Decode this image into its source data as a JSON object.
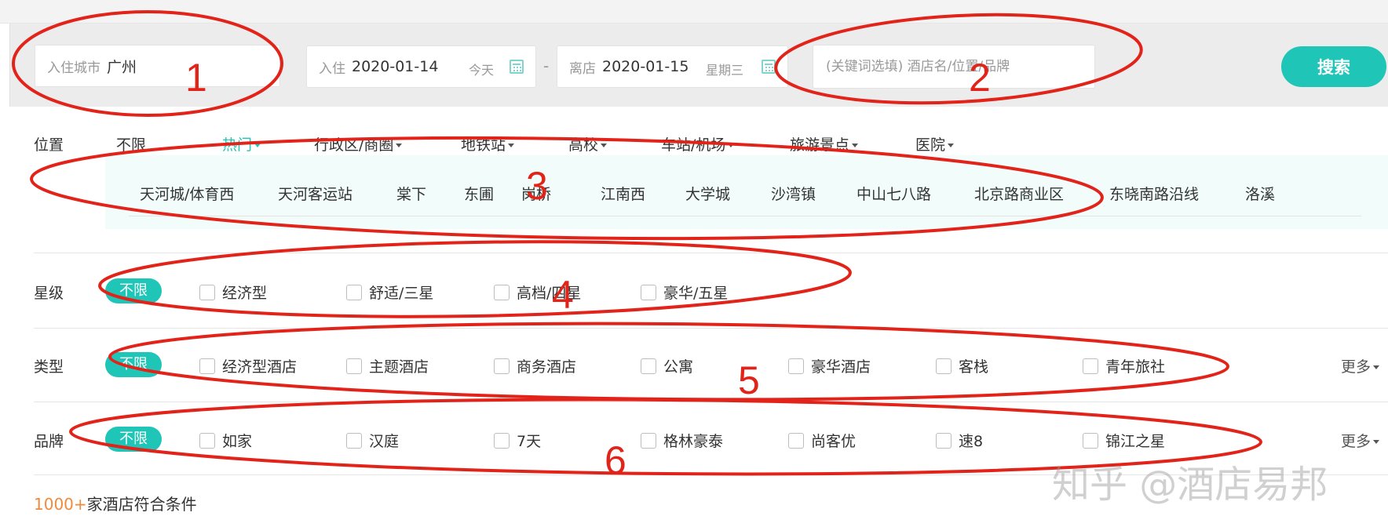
{
  "search": {
    "city_label": "入住城市",
    "city_value": "广州",
    "checkin_label": "入住",
    "checkin_date": "2020-01-14",
    "checkin_day": "今天",
    "dash": "-",
    "checkout_label": "离店",
    "checkout_date": "2020-01-15",
    "checkout_day": "星期三",
    "keyword_placeholder": "(关键词选填) 酒店名/位置/品牌",
    "button": "搜索"
  },
  "location": {
    "label": "位置",
    "tabs": [
      "不限",
      "热门",
      "行政区/商圈",
      "地铁站",
      "高校",
      "车站/机场",
      "旅游景点",
      "医院"
    ],
    "active_tab": "热门",
    "hot_items": [
      "天河城/体育西",
      "天河客运站",
      "棠下",
      "东圃",
      "岗桥",
      "江南西",
      "大学城",
      "沙湾镇",
      "中山七八路",
      "北京路商业区",
      "东晓南路沿线",
      "洛溪"
    ]
  },
  "star": {
    "label": "星级",
    "all": "不限",
    "options": [
      "经济型",
      "舒适/三星",
      "高档/四星",
      "豪华/五星"
    ]
  },
  "type": {
    "label": "类型",
    "all": "不限",
    "options": [
      "经济型酒店",
      "主题酒店",
      "商务酒店",
      "公寓",
      "豪华酒店",
      "客栈",
      "青年旅社"
    ],
    "more": "更多"
  },
  "brand": {
    "label": "品牌",
    "all": "不限",
    "options": [
      "如家",
      "汉庭",
      "7天",
      "格林豪泰",
      "尚客优",
      "速8",
      "锦江之星"
    ],
    "more": "更多"
  },
  "result": {
    "count": "1000+",
    "text": "家酒店符合条件"
  },
  "annotations": [
    "1",
    "2",
    "3",
    "4",
    "5",
    "6"
  ],
  "watermark": "知乎 @酒店易邦",
  "colors": {
    "accent": "#1fc6b8",
    "annotation": "#e2231a",
    "count": "#f08a3c"
  }
}
